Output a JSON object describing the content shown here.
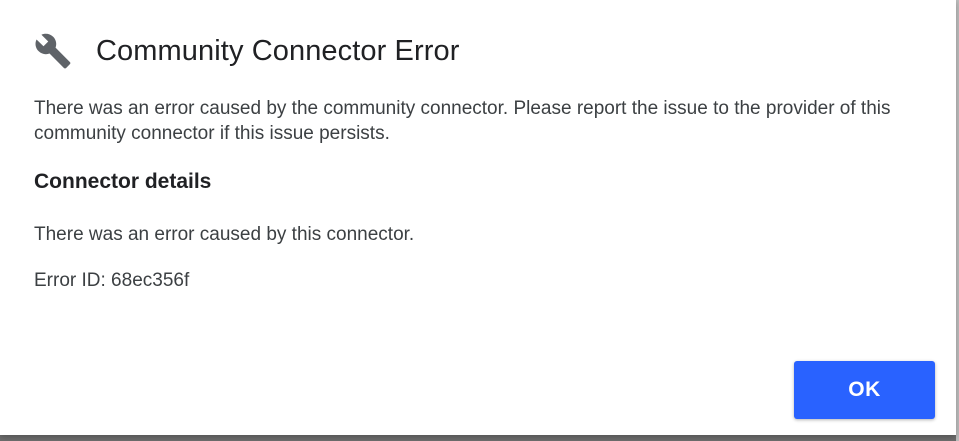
{
  "dialog": {
    "title": "Community Connector Error",
    "icon": "wrench-icon",
    "message": "There was an error caused by the community connector. Please report the issue to the provider of this community connector if this issue persists.",
    "section_title": "Connector details",
    "detail": "There was an error caused by this connector.",
    "error_id": "Error ID: 68ec356f",
    "ok_label": "OK"
  },
  "colors": {
    "accent": "#2962ff",
    "title_text": "#202124",
    "body_text": "#3c4043",
    "icon": "#5f6368"
  }
}
